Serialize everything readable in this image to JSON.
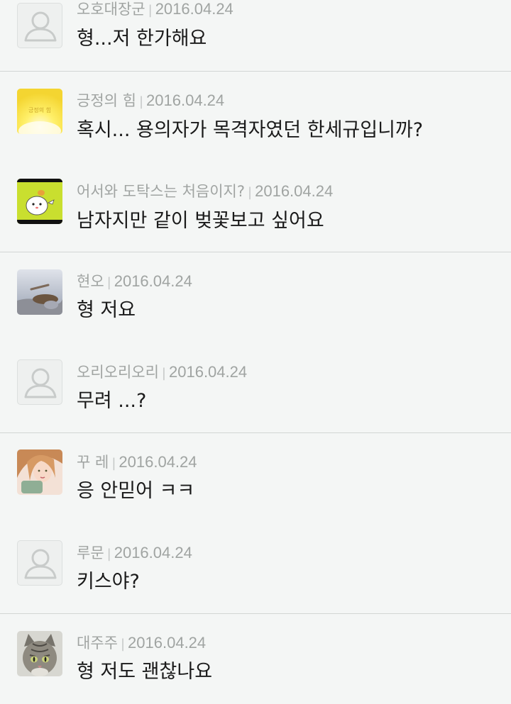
{
  "colors": {
    "background": "#f4f6f5",
    "divider": "#d2d6d4",
    "meta_text": "#a0a4a2",
    "body_text": "#1a1a1a"
  },
  "comments": [
    {
      "author": "오호대장군",
      "date": "2016.04.24",
      "text": "형...저 한가해요",
      "avatar": "default-avatar-icon"
    },
    {
      "author": "긍정의 힘",
      "date": "2016.04.24",
      "text": "혹시... 용의자가 목격자였던 한세규입니까?",
      "avatar": "yellow-sun-avatar",
      "avatar_label": "긍정의 힘"
    },
    {
      "author": "어서와 도탁스는 처음이지?",
      "date": "2016.04.24",
      "text": "남자지만 같이 벚꽃보고 싶어요",
      "avatar": "cartoon-hamster-avatar"
    },
    {
      "author": "현오",
      "date": "2016.04.24",
      "text": "형 저요",
      "avatar": "photo-avatar"
    },
    {
      "author": "오리오리오리",
      "date": "2016.04.24",
      "text": "무려 ...?",
      "avatar": "default-avatar-icon"
    },
    {
      "author": "꾸 레",
      "date": "2016.04.24",
      "text": "응 안믿어 ㅋㅋ",
      "avatar": "portrait-photo-avatar"
    },
    {
      "author": "루문",
      "date": "2016.04.24",
      "text": "키스야?",
      "avatar": "default-avatar-icon"
    },
    {
      "author": "대주주",
      "date": "2016.04.24",
      "text": "형 저도 괜찮나요",
      "avatar": "tabby-cat-avatar"
    }
  ]
}
